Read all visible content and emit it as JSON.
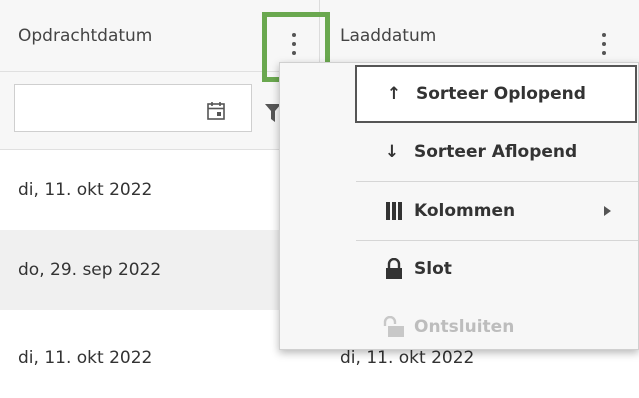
{
  "columns": {
    "first": {
      "label": "Opdrachtdatum"
    },
    "second": {
      "label": "Laaddatum"
    }
  },
  "filter": {
    "value": "",
    "placeholder": ""
  },
  "rows": [
    {
      "col1": "di, 11. okt 2022",
      "col2": ""
    },
    {
      "col1": "do, 29. sep 2022",
      "col2": ""
    },
    {
      "col1": "di, 11. okt 2022",
      "col2": "di, 11. okt 2022"
    }
  ],
  "menu": {
    "sort_asc": {
      "icon": "arrow-up-icon",
      "glyph": "↑",
      "label": "Sorteer Oplopend"
    },
    "sort_desc": {
      "icon": "arrow-down-icon",
      "glyph": "↓",
      "label": "Sorteer Aflopend"
    },
    "columns": {
      "icon": "columns-icon",
      "label": "Kolommen"
    },
    "lock": {
      "icon": "lock-icon",
      "label": "Slot"
    },
    "unlock": {
      "icon": "unlock-icon",
      "label": "Ontsluiten"
    }
  },
  "colors": {
    "highlight": "#6aa84f",
    "header_bg": "#f7f7f7",
    "alt_row": "#f0f0f0",
    "disabled_text": "#bdbdbd"
  }
}
